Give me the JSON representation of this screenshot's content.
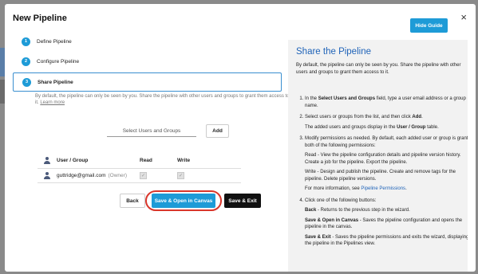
{
  "dialog": {
    "title": "New Pipeline",
    "close_icon": "×",
    "hide_guide_label": "Hide Guide"
  },
  "steps": [
    {
      "number": "1",
      "label": "Define Pipeline"
    },
    {
      "number": "2",
      "label": "Configure Pipeline"
    },
    {
      "number": "3",
      "label": "Share Pipeline"
    }
  ],
  "share": {
    "description": "By default, the pipeline can only be seen by you. Share the pipeline with other users and groups to grant them access to it.",
    "learn_more": "Learn more",
    "select_placeholder": "Select Users and Groups",
    "add_label": "Add"
  },
  "table": {
    "headers": {
      "user": "User / Group",
      "read": "Read",
      "write": "Write"
    },
    "rows": [
      {
        "user": "guttridge@gmail.com",
        "role": "(Owner)",
        "read": true,
        "write": true
      }
    ]
  },
  "buttons": {
    "back": "Back",
    "save_open": "Save & Open in Canvas",
    "save_exit": "Save & Exit"
  },
  "guide": {
    "title": "Share the Pipeline",
    "intro": "By default, the pipeline can only be seen by you. Share the pipeline with other users and groups to grant them access to it.",
    "step1_a": "In the ",
    "step1_b": "Select Users and Groups",
    "step1_c": " field, type a user email address or a group name.",
    "step2_a": "Select users or groups from the list, and then click ",
    "step2_b": "Add",
    "step2_c": ".",
    "step2_note_a": "The added users and groups display in the ",
    "step2_note_b": "User / Group",
    "step2_note_c": " table.",
    "step3": "Modify permissions as needed. By default, each added user or group is granted both of the following permissions:",
    "step3_read": "Read - View the pipeline configuration details and pipeline version history. Create a job for the pipeline. Export the pipeline.",
    "step3_write": "Write - Design and publish the pipeline. Create and remove tags for the pipeline. Delete pipeline versions.",
    "step3_more_a": "For more information, see ",
    "step3_more_link": "Pipeline Permissions",
    "step3_more_c": ".",
    "step4": "Click one of the following buttons:",
    "step4_back_b": "Back",
    "step4_back": " - Returns to the previous step in the wizard.",
    "step4_saveopen_b": "Save & Open in Canvas",
    "step4_saveopen": " - Saves the pipeline configuration and opens the pipeline in the canvas.",
    "step4_saveexit_b": "Save & Exit",
    "step4_saveexit": " - Saves the pipeline permissions and exits the wizard, displaying the pipeline in the Pipelines view."
  },
  "colors": {
    "accent": "#1e9bd7",
    "highlight_ring": "#d9362b",
    "link": "#1f63b8"
  }
}
